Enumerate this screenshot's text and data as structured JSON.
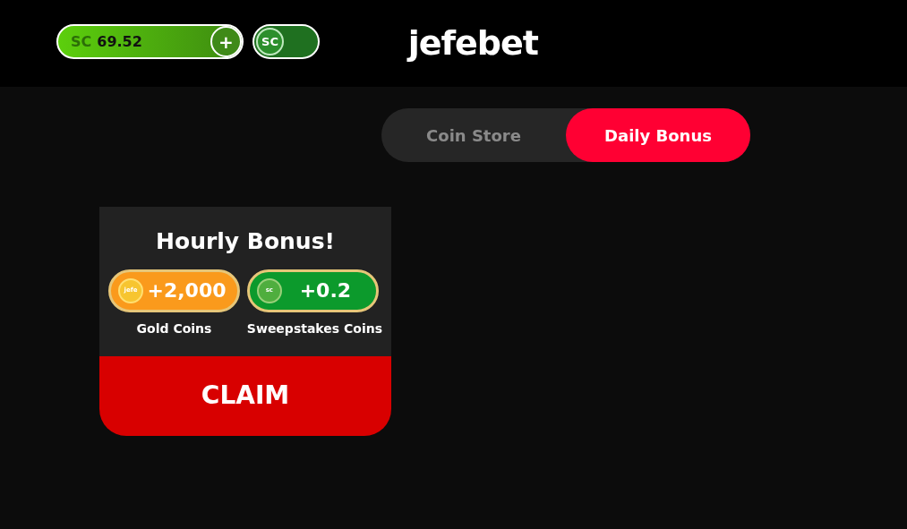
{
  "header": {
    "balance": {
      "currency": "SC",
      "amount": "69.52",
      "add_button": "+"
    },
    "coin_toggle": {
      "label": "SC"
    },
    "logo": "jefebet"
  },
  "tabs": [
    {
      "label": "Coin Store",
      "selected": false
    },
    {
      "label": "Daily Bonus",
      "selected": true
    }
  ],
  "bonus_card": {
    "title": "Hourly Bonus!",
    "rewards": [
      {
        "kind": "gold",
        "icon_text": "jefe",
        "amount": "+2,000",
        "label": "Gold Coins"
      },
      {
        "kind": "sweeps",
        "icon_text": "sc",
        "amount": "+0.2",
        "label": "Sweepstakes Coins"
      }
    ],
    "claim_button": "CLAIM"
  }
}
